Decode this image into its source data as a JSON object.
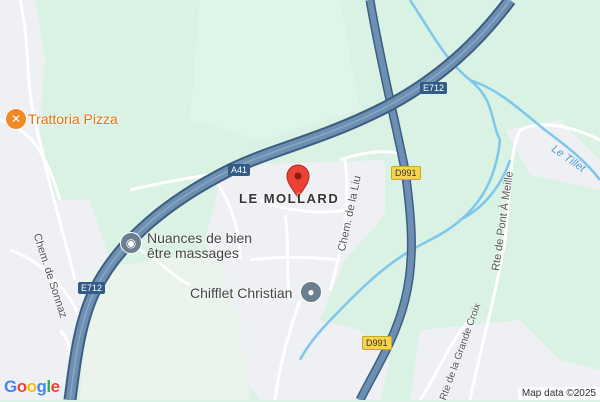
{
  "pois": {
    "trattoria": {
      "label": "Trattoria Pizza",
      "icon": "restaurant-icon",
      "color": "#f08a24"
    },
    "nuances": {
      "line1": "Nuances de bien",
      "line2": "être massages",
      "icon": "spa-icon",
      "color": "#6b7f8e"
    },
    "chifflet": {
      "label": "Chifflet Christian",
      "icon": "place-icon",
      "color": "#6b7f8e"
    }
  },
  "place": {
    "label": "LE MOLLARD"
  },
  "streets": {
    "sonnaz": "Chem. de Sonnaz",
    "liu": "Chem. de la Liu",
    "pont_meille": "Rte de Pont À Meille",
    "grande_croix": "Rte de la Grande Croix"
  },
  "river": {
    "label": "Le Tillet"
  },
  "shields": {
    "a41": "A41",
    "e712_top": "E712",
    "e712_bottom": "E712",
    "d991_top": "D991",
    "d991_bottom": "D991"
  },
  "marker": {
    "icon": "map-pin-icon",
    "color": "#ea4335"
  },
  "colors": {
    "land": "#d9f2e3",
    "urban": "#eef0f3",
    "highway": "#6d8fb1",
    "highway_casing": "#3d5e82",
    "water": "#7dc7ec"
  },
  "attribution": "Map data ©2025",
  "logo": "Google"
}
